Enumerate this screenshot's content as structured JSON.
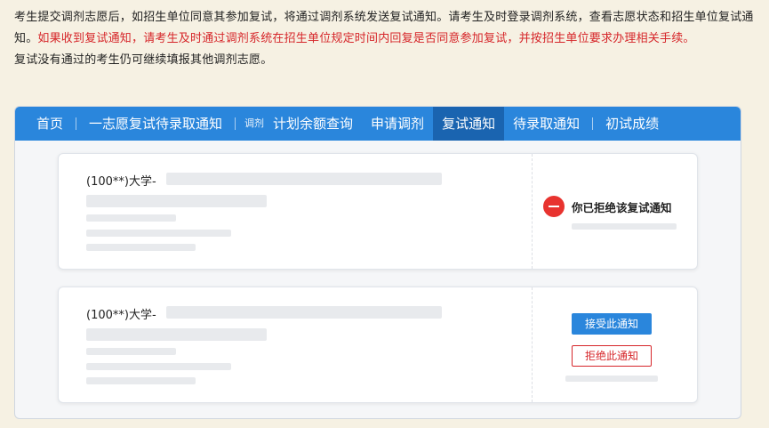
{
  "intro": {
    "line1": "考生提交调剂志愿后，如招生单位同意其参加复试，将通过调剂系统发送复试通知。请考生及时登录调剂系统，查看志愿状态和招生单位复试通知。",
    "warning": "如果收到复试通知，请考生及时通过调剂系统在招生单位规定时间内回复是否同意参加复试，并按招生单位要求办理相关手续。",
    "line2": "复试没有通过的考生仍可继续填报其他调剂志愿。"
  },
  "nav": {
    "home": "首页",
    "first_choice": "一志愿复试待录取通知",
    "adjust_tag": "调剂",
    "quota": "计划余额查询",
    "apply": "申请调剂",
    "retest": "复试通知",
    "pending": "待录取通知",
    "scores": "初试成绩",
    "active": "复试通知"
  },
  "cards": [
    {
      "school": "(100**)大学-",
      "status_text": "你已拒绝该复试通知"
    },
    {
      "school": "(100**)大学-",
      "accept_label": "接受此通知",
      "reject_label": "拒绝此通知"
    }
  ],
  "colors": {
    "accent": "#2a86dc",
    "nav_active": "#1a64b0",
    "warning": "#d6262a",
    "rejected_icon": "#e8332f"
  },
  "icons": {
    "rejected_status": "minus-circle-icon"
  }
}
